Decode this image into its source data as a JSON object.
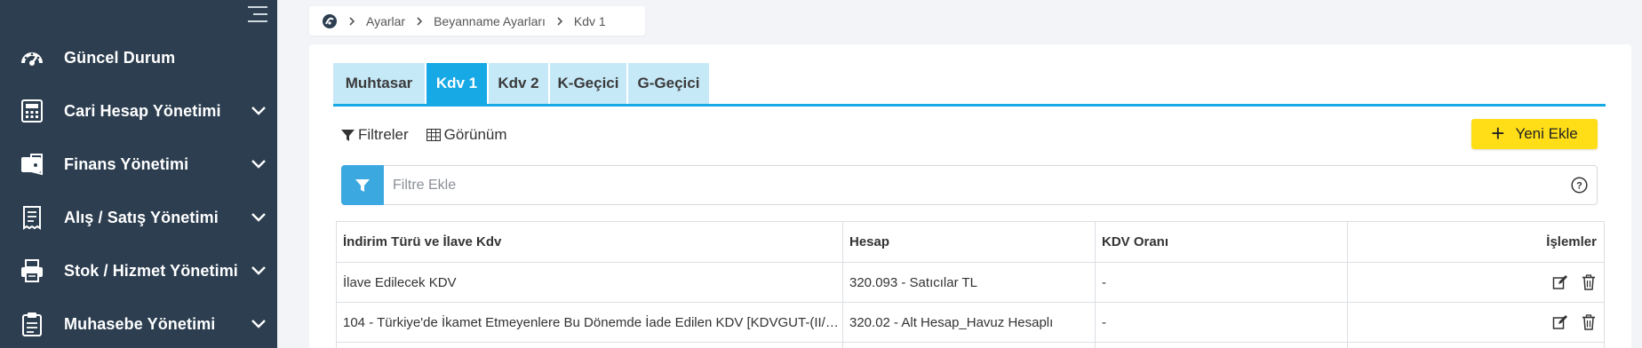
{
  "sidebar": {
    "items": [
      {
        "label": "Güncel Durum",
        "icon": "dashboard-icon",
        "has_chevron": false
      },
      {
        "label": "Cari Hesap Yönetimi",
        "icon": "calculator-icon",
        "has_chevron": true
      },
      {
        "label": "Finans Yönetimi",
        "icon": "wallet-icon",
        "has_chevron": true
      },
      {
        "label": "Alış / Satış Yönetimi",
        "icon": "receipt-icon",
        "has_chevron": true
      },
      {
        "label": "Stok / Hizmet Yönetimi",
        "icon": "printer-icon",
        "has_chevron": true
      },
      {
        "label": "Muhasebe Yönetimi",
        "icon": "clipboard-icon",
        "has_chevron": true
      }
    ]
  },
  "breadcrumb": {
    "items": [
      "Ayarlar",
      "Beyanname Ayarları",
      "Kdv 1"
    ]
  },
  "tabs": [
    {
      "label": "Muhtasar",
      "active": false
    },
    {
      "label": "Kdv 1",
      "active": true
    },
    {
      "label": "Kdv 2",
      "active": false
    },
    {
      "label": "K-Geçici",
      "active": false
    },
    {
      "label": "G-Geçici",
      "active": false
    }
  ],
  "toolbar": {
    "filters_label": "Filtreler",
    "view_label": "Görünüm",
    "new_button_label": "Yeni Ekle"
  },
  "filter": {
    "placeholder": "Filtre Ekle"
  },
  "table": {
    "headers": [
      "İndirim Türü ve İlave Kdv",
      "Hesap",
      "KDV Oranı",
      "İşlemler"
    ],
    "rows": [
      {
        "type": "İlave Edilecek KDV",
        "account": "320.093 - Satıcılar TL",
        "rate": "-"
      },
      {
        "type": "104 - Türkiye'de İkamet Etmeyenlere Bu Dönemde İade Edilen KDV [KDVGUT-(II/A...",
        "account": "320.02 - Alt Hesap_Havuz Hesaplı",
        "rate": "-"
      }
    ]
  },
  "colors": {
    "sidebar_bg": "#2c3e50",
    "accent": "#17a9e6",
    "tab_inactive": "#c6e9f8",
    "primary_button": "#ffde17"
  }
}
